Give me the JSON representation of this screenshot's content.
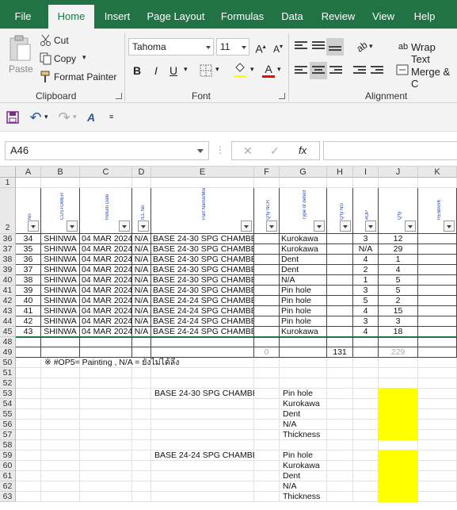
{
  "menu": {
    "tabs": [
      "File",
      "Home",
      "Insert",
      "Page Layout",
      "Formulas",
      "Data",
      "Review",
      "View",
      "Help"
    ],
    "active": "Home"
  },
  "ribbon": {
    "clipboard": {
      "paste": "Paste",
      "cut": "Cut",
      "copy": "Copy",
      "format_painter": "Format Painter",
      "label": "Clipboard"
    },
    "font": {
      "name": "Tahoma",
      "size": "11",
      "bold": "B",
      "italic": "I",
      "underline": "U",
      "label": "Font"
    },
    "alignment": {
      "wrap_text": "Wrap Text",
      "merge": "Merge & C",
      "label": "Alignment"
    },
    "fill_color": "#ffff00",
    "font_color": "#ff0000"
  },
  "formula_bar": {
    "name_box": "A46",
    "fx": "fx",
    "value": ""
  },
  "columns": [
    "A",
    "B",
    "C",
    "D",
    "E",
    "F",
    "G",
    "H",
    "I",
    "J",
    "K"
  ],
  "headers": {
    "A": "No",
    "B": "CUSTOMER",
    "C": "Return Date",
    "D": "ICL No",
    "E": "Part Name/Model",
    "F": "Q'ty NCR",
    "G": "Type of defect",
    "H": "Q'ty NG",
    "I": "#OP",
    "J": "Q'ty",
    "K": "REMARK"
  },
  "rows": [
    {
      "r": "36",
      "no": "34",
      "cust": "SHINWA",
      "date": "04 MAR 2024",
      "icl": "N/A",
      "part": "BASE 24-30 SPG CHAMBER",
      "defect": "Kurokawa",
      "op": "3",
      "qty": "12"
    },
    {
      "r": "37",
      "no": "35",
      "cust": "SHINWA",
      "date": "04 MAR 2024",
      "icl": "N/A",
      "part": "BASE 24-30 SPG CHAMBER",
      "defect": "Kurokawa",
      "op": "N/A",
      "qty": "29"
    },
    {
      "r": "38",
      "no": "36",
      "cust": "SHINWA",
      "date": "04 MAR 2024",
      "icl": "N/A",
      "part": "BASE 24-30 SPG CHAMBER",
      "defect": "Dent",
      "op": "4",
      "qty": "1"
    },
    {
      "r": "39",
      "no": "37",
      "cust": "SHINWA",
      "date": "04 MAR 2024",
      "icl": "N/A",
      "part": "BASE 24-30 SPG CHAMBER",
      "defect": "Dent",
      "op": "2",
      "qty": "4"
    },
    {
      "r": "40",
      "no": "38",
      "cust": "SHINWA",
      "date": "04 MAR 2024",
      "icl": "N/A",
      "part": "BASE 24-30 SPG CHAMBER",
      "defect": "N/A",
      "op": "1",
      "qty": "5"
    },
    {
      "r": "41",
      "no": "39",
      "cust": "SHINWA",
      "date": "04 MAR 2024",
      "icl": "N/A",
      "part": "BASE 24-30 SPG CHAMBER",
      "defect": "Pin hole",
      "op": "3",
      "qty": "5"
    },
    {
      "r": "42",
      "no": "40",
      "cust": "SHINWA",
      "date": "04 MAR 2024",
      "icl": "N/A",
      "part": "BASE 24-24 SPG CHAMBER",
      "defect": "Pin hole",
      "op": "5",
      "qty": "2"
    },
    {
      "r": "43",
      "no": "41",
      "cust": "SHINWA",
      "date": "04 MAR 2024",
      "icl": "N/A",
      "part": "BASE 24-24 SPG CHAMBER",
      "defect": "Pin hole",
      "op": "4",
      "qty": "15"
    },
    {
      "r": "44",
      "no": "42",
      "cust": "SHINWA",
      "date": "04 MAR 2024",
      "icl": "N/A",
      "part": "BASE 24-24 SPG CHAMBER",
      "defect": "Pin hole",
      "op": "3",
      "qty": "3"
    },
    {
      "r": "45",
      "no": "43",
      "cust": "SHINWA",
      "date": "04 MAR 2024",
      "icl": "N/A",
      "part": "BASE 24-24 SPG CHAMBER",
      "defect": "Kurokawa",
      "op": "4",
      "qty": "18"
    }
  ],
  "totals": {
    "f": "0",
    "h": "131",
    "j": "229"
  },
  "note": "※ #OP5= Painting , N/A = ยังไม่ได้ลึง",
  "summary": [
    {
      "part": "BASE 24-30 SPG CHAMBER",
      "defects": [
        "Pin hole",
        "Kurokawa",
        "Dent",
        "N/A",
        "Thickness"
      ]
    },
    {
      "part": "BASE 24-24 SPG CHAMBER",
      "defects": [
        "Pin hole",
        "Kurokawa",
        "Dent",
        "N/A",
        "Thickness"
      ]
    }
  ],
  "lower_rows": [
    "48",
    "49",
    "50",
    "51",
    "52",
    "53",
    "54",
    "55",
    "56",
    "57",
    "58",
    "59",
    "60",
    "61",
    "62",
    "63"
  ]
}
